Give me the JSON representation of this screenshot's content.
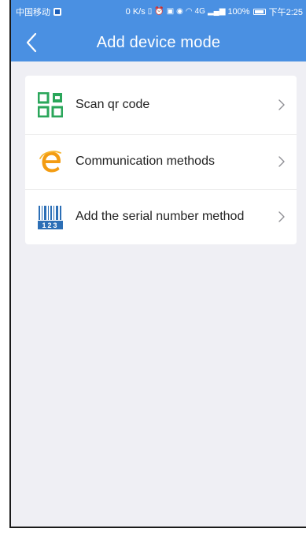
{
  "status_bar": {
    "carrier": "中国移动",
    "speed": "0 K/s",
    "network": "4G",
    "battery": "100%",
    "time": "下午2:25"
  },
  "nav": {
    "title": "Add device mode"
  },
  "menu": {
    "items": [
      {
        "label": "Scan qr code",
        "icon": "qr-code-icon"
      },
      {
        "label": "Communication methods",
        "icon": "ie-browser-icon"
      },
      {
        "label": "Add the serial number method",
        "icon": "barcode-serial-icon"
      }
    ]
  },
  "colors": {
    "header": "#4a90e2",
    "background": "#efeff4",
    "qr_green": "#2aa65a",
    "ie_orange": "#f39c12",
    "barcode_blue": "#2c6fb6"
  }
}
